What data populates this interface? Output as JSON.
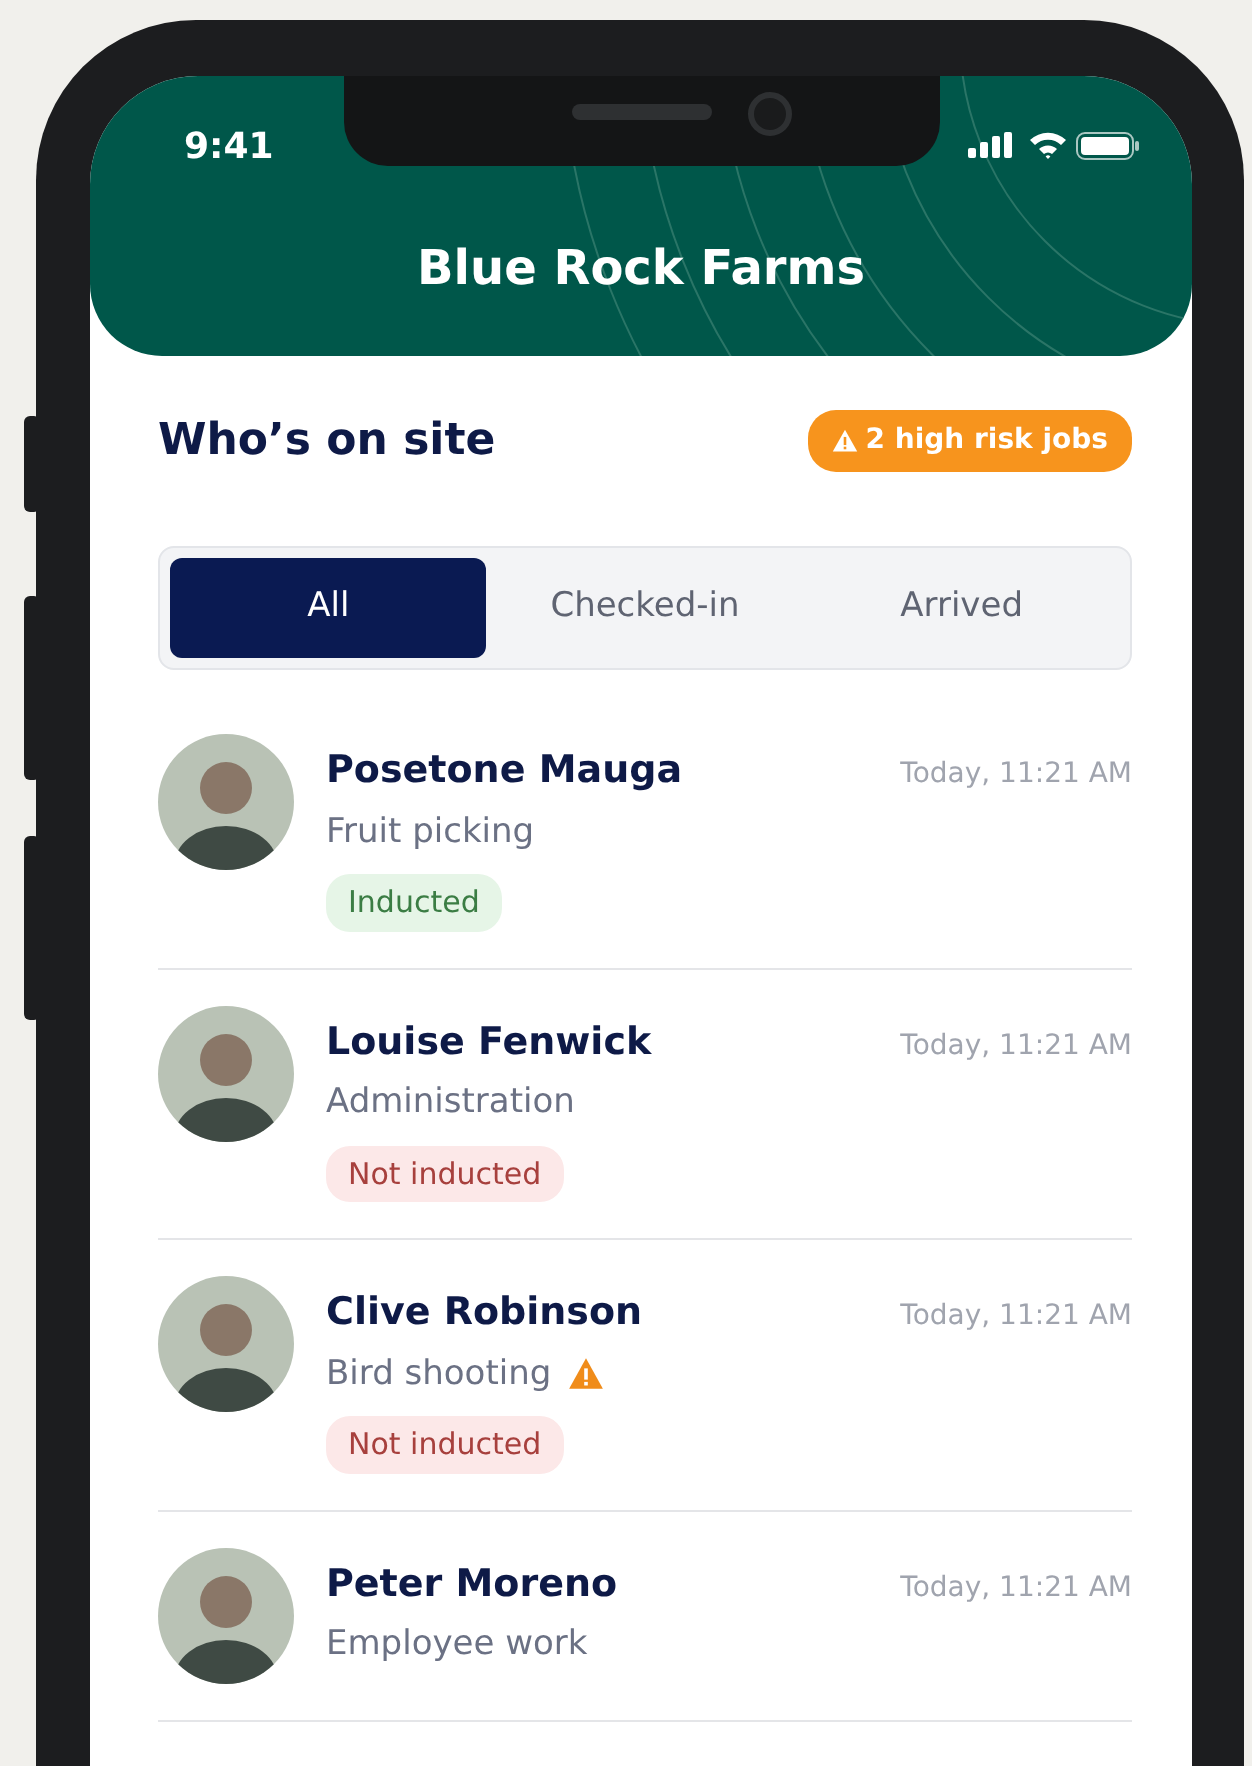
{
  "status_bar": {
    "time": "9:41"
  },
  "header": {
    "title": "Blue Rock Farms"
  },
  "section": {
    "title": "Who’s on site",
    "alert": "2 high risk jobs"
  },
  "tabs": [
    {
      "label": "All",
      "selected": true
    },
    {
      "label": "Checked-in",
      "selected": false
    },
    {
      "label": "Arrived",
      "selected": false
    }
  ],
  "people": [
    {
      "name": "Posetone Mauga",
      "job": "Fruit picking",
      "high_risk": false,
      "time": "Today, 11:21 AM",
      "status": {
        "kind": "inducted",
        "label": "Inducted"
      }
    },
    {
      "name": "Louise Fenwick",
      "job": "Administration",
      "high_risk": false,
      "time": "Today, 11:21 AM",
      "status": {
        "kind": "not_inducted",
        "label": "Not inducted"
      }
    },
    {
      "name": "Clive Robinson",
      "job": "Bird shooting",
      "high_risk": true,
      "time": "Today, 11:21 AM",
      "status": {
        "kind": "not_inducted",
        "label": "Not inducted"
      }
    },
    {
      "name": "Peter Moreno",
      "job": "Employee work",
      "high_risk": false,
      "time": "Today, 11:21 AM"
    }
  ]
}
